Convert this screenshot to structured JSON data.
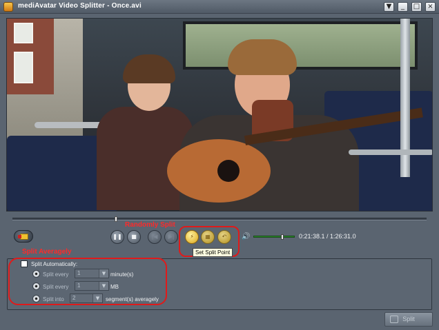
{
  "window": {
    "title": "mediAvatar Video Splitter  - Once.avi",
    "controls": [
      "▼",
      "_",
      "□",
      "×"
    ]
  },
  "player": {
    "seek_fraction": 0.25,
    "volume_fraction": 0.68,
    "time_display": "0:21:38.1 / 1:26:31.0"
  },
  "annotations": {
    "randomly_split": "Randomly Split",
    "split_averagely": "Split Averagely"
  },
  "toolbar": {
    "tooltip": "Set Split Point",
    "icons": [
      "add-file-icon",
      "pause-icon",
      "stop-icon",
      "previous-icon",
      "next-icon",
      "set-split-point-icon",
      "segment-icon",
      "undo-icon",
      "volume-icon"
    ]
  },
  "split_options": {
    "auto_label": "Split Automatically:",
    "every_minutes_label": "Split every",
    "every_minutes_value": "1",
    "every_minutes_unit": "minute(s)",
    "every_mb_label": "Split every",
    "every_mb_value": "1",
    "every_mb_unit": "MB",
    "into_label": "Split into",
    "into_value": "2",
    "into_unit": "segment(s) averagely"
  },
  "actions": {
    "split_label": "Split"
  }
}
